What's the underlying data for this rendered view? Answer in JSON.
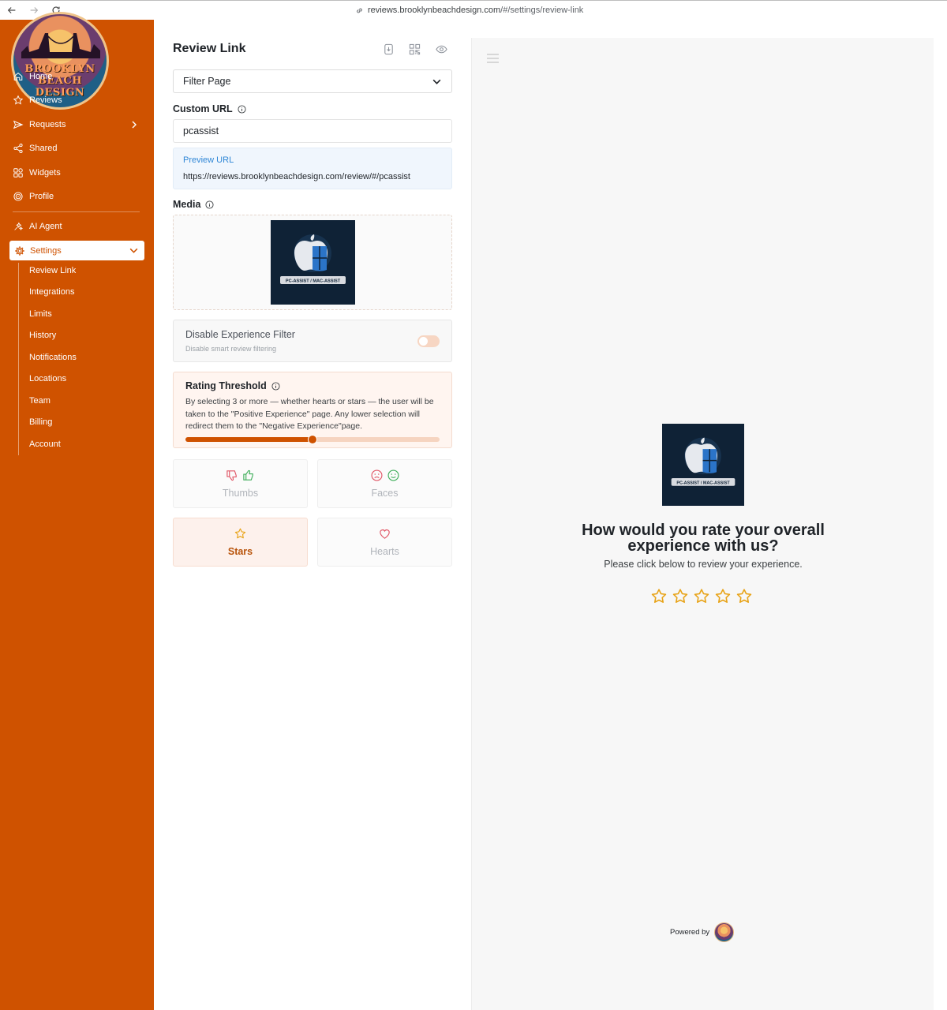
{
  "browser": {
    "url_host": "reviews.brooklynbeachdesign.com",
    "url_path": "/#/settings/review-link"
  },
  "sidebar": {
    "logo_text_line1": "BROOKLYN",
    "logo_text_line2": "BEACH DESIGN",
    "items": [
      {
        "label": "Home",
        "icon": "home-icon"
      },
      {
        "label": "Reviews",
        "icon": "star-icon"
      },
      {
        "label": "Requests",
        "icon": "send-icon"
      },
      {
        "label": "Shared",
        "icon": "share-icon"
      },
      {
        "label": "Widgets",
        "icon": "widgets-icon"
      },
      {
        "label": "Profile",
        "icon": "profile-icon"
      },
      {
        "label": "AI Agent",
        "icon": "ai-agent-icon"
      },
      {
        "label": "Settings",
        "icon": "gear-icon"
      }
    ],
    "settings_submenu": [
      "Review Link",
      "Integrations",
      "Limits",
      "History",
      "Notifications",
      "Locations",
      "Team",
      "Billing",
      "Account"
    ],
    "accent_color": "#cf5200"
  },
  "panel": {
    "title": "Review Link",
    "page_select": "Filter Page",
    "custom_url_label": "Custom URL",
    "custom_url_value": "pcassist",
    "preview_url_label": "Preview URL",
    "preview_url_value": "https://reviews.brooklynbeachdesign.com/review/#/pcassist",
    "media_label": "Media",
    "media_logo_text": "PC-ASSIST / MAC-ASSIST",
    "experience_filter_title": "Disable Experience Filter",
    "experience_filter_subtitle": "Disable smart review filtering",
    "experience_filter_enabled": false,
    "rating_threshold_title": "Rating Threshold",
    "rating_threshold_description": "By selecting 3 or more — whether hearts or stars — the user will be taken to the \"Positive Experience\" page. Any lower selection will redirect them to the \"Negative Experience\"page.",
    "rating_threshold_value": 3,
    "rating_threshold_max": 5,
    "rating_types": [
      {
        "label": "Thumbs",
        "active": false
      },
      {
        "label": "Faces",
        "active": false
      },
      {
        "label": "Stars",
        "active": true
      },
      {
        "label": "Hearts",
        "active": false
      }
    ]
  },
  "preview": {
    "logo_text": "PC-ASSIST / MAC-ASSIST",
    "title": "How would you rate your overall experience with us?",
    "subtitle": "Please click below to review your experience.",
    "star_count": 5,
    "powered_by": "Powered by"
  }
}
